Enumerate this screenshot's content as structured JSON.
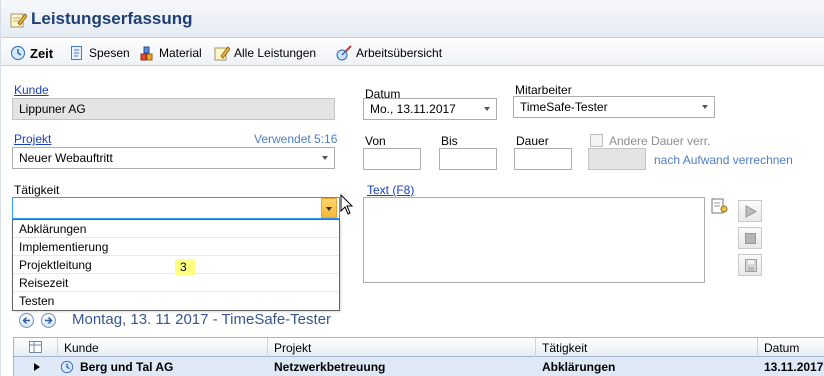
{
  "window": {
    "title": "Leistungserfassung"
  },
  "tabs": [
    {
      "label": "Zeit",
      "icon": "clock-icon",
      "active": true
    },
    {
      "label": "Spesen",
      "icon": "receipt-icon"
    },
    {
      "label": "Material",
      "icon": "material-icon"
    },
    {
      "label": "Alle Leistungen",
      "icon": "pencil-icon"
    },
    {
      "label": "Arbeitsübersicht",
      "icon": "overview-icon"
    }
  ],
  "form": {
    "kunde_label": "Kunde",
    "kunde_value": "Lippuner AG",
    "datum_label": "Datum",
    "datum_value": "Mo., 13.11.2017",
    "mitarbeiter_label": "Mitarbeiter",
    "mitarbeiter_value": "TimeSafe-Tester",
    "projekt_label": "Projekt",
    "projekt_hint": "Verwendet 5:16",
    "projekt_value": "Neuer Webauftritt",
    "von_label": "Von",
    "bis_label": "Bis",
    "dauer_label": "Dauer",
    "andere_dauer_label": "Andere Dauer verr.",
    "nach_aufwand_label": "nach Aufwand verrechnen",
    "taetigkeit_label": "Tätigkeit",
    "taetigkeit_value": "",
    "text_label": "Text (F8)"
  },
  "dropdown": {
    "items": [
      "Abklärungen",
      "Implementierung",
      "Projektleitung",
      "Reisezeit",
      "Testen"
    ],
    "badge": "3"
  },
  "nav": {
    "label": "Montag, 13. 11 2017 - TimeSafe-Tester"
  },
  "grid": {
    "columns": [
      "Kunde",
      "Projekt",
      "Tätigkeit",
      "Datum"
    ],
    "rows": [
      {
        "kunde": "Berg und Tal AG",
        "projekt": "Netzwerkbetreuung",
        "taetigkeit": "Abklärungen",
        "datum": "13.11.2017"
      }
    ]
  },
  "colors": {
    "accent": "#1f3f77",
    "link": "#1a3fc4",
    "hint": "#4d7fc6",
    "grid_row": "#dfe8f6",
    "badge": "#ffff80"
  }
}
